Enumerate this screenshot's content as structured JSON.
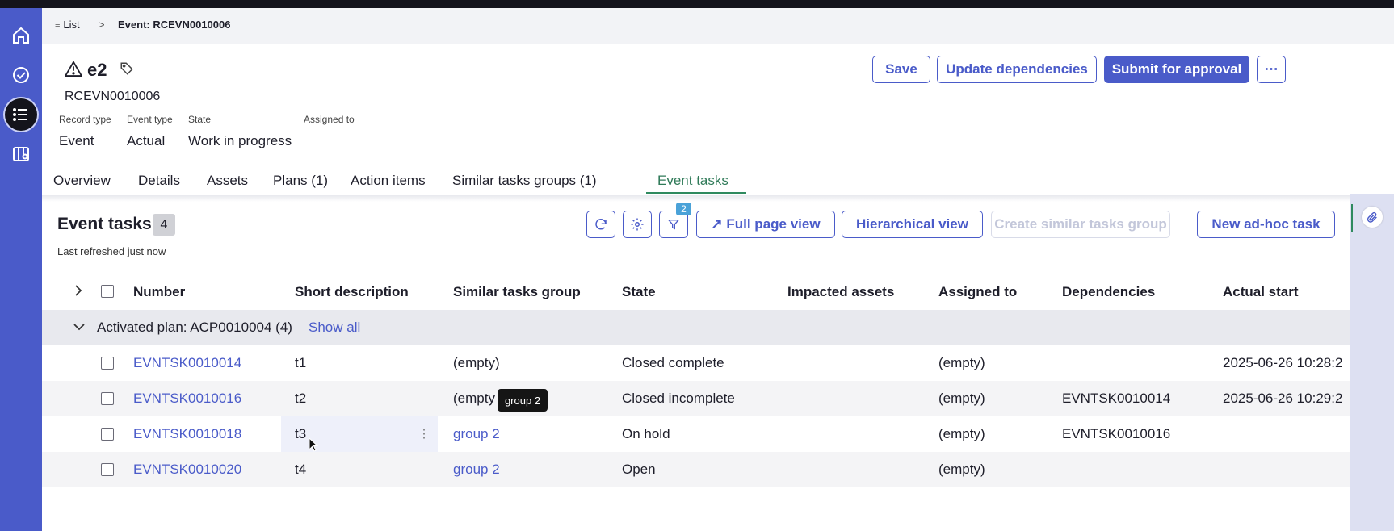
{
  "breadcrumb": {
    "list_label": "List",
    "separator": ">",
    "current": "Event: RCEVN0010006"
  },
  "record": {
    "title": "e2",
    "number": "RCEVN0010006",
    "fields": [
      {
        "label": "Record type",
        "value": "Event"
      },
      {
        "label": "Event type",
        "value": "Actual"
      },
      {
        "label": "State",
        "value": "Work in progress"
      },
      {
        "label": "Assigned to",
        "value": ""
      }
    ]
  },
  "actions": {
    "save": "Save",
    "update_dependencies": "Update dependencies",
    "submit": "Submit for approval",
    "more": "⋯"
  },
  "tabs": [
    "Overview",
    "Details",
    "Assets",
    "Plans (1)",
    "Action items",
    "Similar tasks groups (1)",
    "Event tasks"
  ],
  "active_tab": "Event tasks",
  "section": {
    "title": "Event tasks",
    "count": "4",
    "subtitle": "Last refreshed just now",
    "filter_badge": "2",
    "buttons": {
      "full_page": "↗ Full page view",
      "hierarchical": "Hierarchical view",
      "create_group": "Create similar tasks group",
      "new_task": "New ad-hoc task"
    }
  },
  "table": {
    "columns": [
      "Number",
      "Short description",
      "Similar tasks group",
      "State",
      "Impacted assets",
      "Assigned to",
      "Dependencies",
      "Actual start"
    ],
    "group_label": "Activated plan: ACP0010004 (4)",
    "show_all": "Show all",
    "rows": [
      {
        "number": "EVNTSK0010014",
        "short": "t1",
        "group": "(empty)",
        "state": "Closed complete",
        "assets": "",
        "assigned": "(empty)",
        "deps": "",
        "start": "2025-06-26 10:28:2"
      },
      {
        "number": "EVNTSK0010016",
        "short": "t2",
        "group": "(empty",
        "state": "Closed incomplete",
        "assets": "",
        "assigned": "(empty)",
        "deps": "EVNTSK0010014",
        "start": "2025-06-26 10:29:2"
      },
      {
        "number": "EVNTSK0010018",
        "short": "t3",
        "group": "group 2",
        "state": "On hold",
        "assets": "",
        "assigned": "(empty)",
        "deps": "EVNTSK0010016",
        "start": ""
      },
      {
        "number": "EVNTSK0010020",
        "short": "t4",
        "group": "group 2",
        "state": "Open",
        "assets": "",
        "assigned": "(empty)",
        "deps": "",
        "start": ""
      }
    ]
  },
  "tooltip": "group 2",
  "colors": {
    "sidebar": "#4a5bc9",
    "accent": "#4a5bc9",
    "active_tab": "#2f7a58",
    "topbar": "#14141c"
  },
  "icons": [
    "home-icon",
    "check-circle-icon",
    "list-icon",
    "map-icon",
    "warning-icon",
    "tag-icon",
    "refresh-icon",
    "gear-icon",
    "filter-icon",
    "chevron-right-icon",
    "chevron-down-icon",
    "paperclip-icon",
    "kebab-icon"
  ]
}
